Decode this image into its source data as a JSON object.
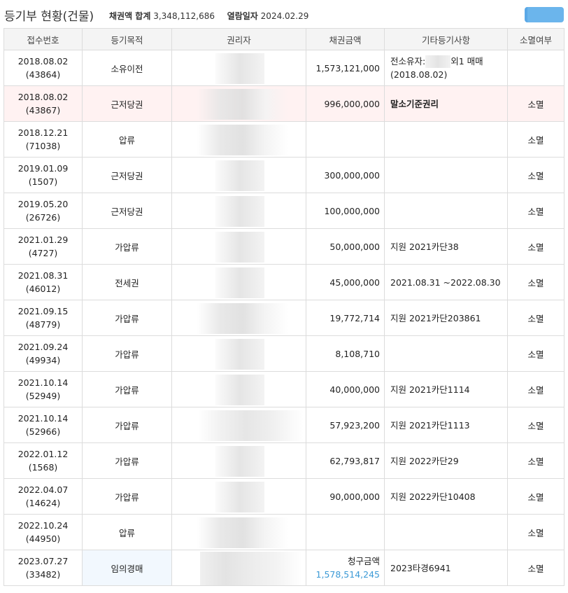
{
  "header": {
    "title": "등기부 현황(건물)",
    "total_label": "채권액 합계",
    "total_value": "3,348,112,686",
    "view_date_label": "열람일자",
    "view_date_value": "2024.02.29"
  },
  "table": {
    "columns": [
      "접수번호",
      "등기목적",
      "권리자",
      "채권금액",
      "기타등기사항",
      "소멸여부"
    ],
    "rows": [
      {
        "date": "2018.08.02",
        "no": "(43864)",
        "purpose": "소유이전",
        "amount": "1,573,121,000",
        "note_prefix": "전소유자:",
        "note_suffix": "외1 매매(2018.08.02)",
        "extinct": ""
      },
      {
        "date": "2018.08.02",
        "no": "(43867)",
        "purpose": "근저당권",
        "amount": "996,000,000",
        "note": "말소기준권리",
        "extinct": "소멸"
      },
      {
        "date": "2018.12.21",
        "no": "(71038)",
        "purpose": "압류",
        "amount": "",
        "note": "",
        "extinct": "소멸"
      },
      {
        "date": "2019.01.09",
        "no": "(1507)",
        "purpose": "근저당권",
        "amount": "300,000,000",
        "note": "",
        "extinct": "소멸"
      },
      {
        "date": "2019.05.20",
        "no": "(26726)",
        "purpose": "근저당권",
        "amount": "100,000,000",
        "note": "",
        "extinct": "소멸"
      },
      {
        "date": "2021.01.29",
        "no": "(4727)",
        "purpose": "가압류",
        "amount": "50,000,000",
        "note": "지원 2021카단38",
        "extinct": "소멸"
      },
      {
        "date": "2021.08.31",
        "no": "(46012)",
        "purpose": "전세권",
        "amount": "45,000,000",
        "note": "2021.08.31 ~2022.08.30",
        "extinct": "소멸"
      },
      {
        "date": "2021.09.15",
        "no": "(48779)",
        "purpose": "가압류",
        "amount": "19,772,714",
        "note": "지원 2021카단203861",
        "extinct": "소멸"
      },
      {
        "date": "2021.09.24",
        "no": "(49934)",
        "purpose": "가압류",
        "amount": "8,108,710",
        "note": "",
        "extinct": "소멸"
      },
      {
        "date": "2021.10.14",
        "no": "(52949)",
        "purpose": "가압류",
        "amount": "40,000,000",
        "note": "지원 2021카단1114",
        "extinct": "소멸"
      },
      {
        "date": "2021.10.14",
        "no": "(52966)",
        "purpose": "가압류",
        "amount": "57,923,200",
        "note": "지원 2021카단1113",
        "extinct": "소멸"
      },
      {
        "date": "2022.01.12",
        "no": "(1568)",
        "purpose": "가압류",
        "amount": "62,793,817",
        "note": "지원 2022카단29",
        "extinct": "소멸"
      },
      {
        "date": "2022.04.07",
        "no": "(14624)",
        "purpose": "가압류",
        "amount": "90,000,000",
        "note": "지원 2022카단10408",
        "extinct": "소멸"
      },
      {
        "date": "2022.10.24",
        "no": "(44950)",
        "purpose": "압류",
        "amount": "",
        "note": "",
        "extinct": "소멸"
      },
      {
        "date": "2023.07.27",
        "no": "(33482)",
        "purpose": "임의경매",
        "claim_label": "청구금액",
        "claim_value": "1,578,514,245",
        "note": "2023타경6941",
        "extinct": "소멸"
      }
    ]
  },
  "colors": {
    "accent": "#6bb5ec",
    "link": "#3c9ad6",
    "highlight_row": "#fff2f2",
    "highlight_cell": "#f2f8fe"
  }
}
